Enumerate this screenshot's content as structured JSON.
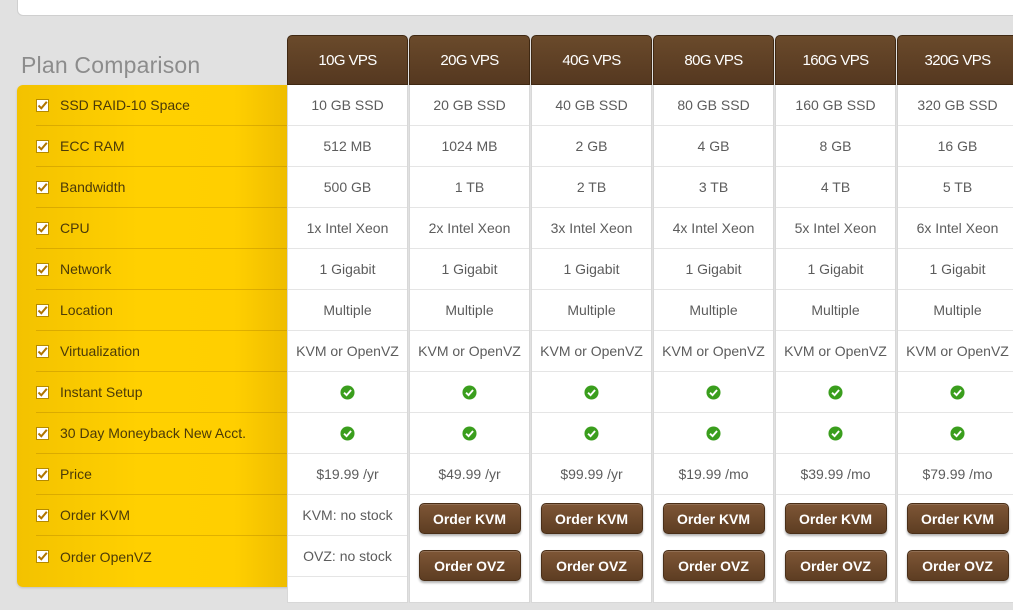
{
  "title": "Plan Comparison",
  "features": [
    "SSD RAID-10 Space",
    "ECC RAM",
    "Bandwidth",
    "CPU",
    "Network",
    "Location",
    "Virtualization",
    "Instant Setup",
    "30 Day Moneyback New Acct.",
    "Price",
    "Order KVM",
    "Order OpenVZ"
  ],
  "plans": [
    {
      "name": "10G VPS",
      "space": "10 GB SSD",
      "ram": "512 MB",
      "bandwidth": "500 GB",
      "cpu": "1x Intel Xeon",
      "network": "1 Gigabit",
      "location": "Multiple",
      "virt": "KVM or OpenVZ",
      "price": "$19.99 /yr",
      "kvm": "KVM: no stock",
      "ovz": "OVZ: no stock"
    },
    {
      "name": "20G VPS",
      "space": "20 GB SSD",
      "ram": "1024 MB",
      "bandwidth": "1 TB",
      "cpu": "2x Intel Xeon",
      "network": "1 Gigabit",
      "location": "Multiple",
      "virt": "KVM or OpenVZ",
      "price": "$49.99 /yr",
      "kvm": "Order KVM",
      "ovz": "Order OVZ"
    },
    {
      "name": "40G VPS",
      "space": "40 GB SSD",
      "ram": "2 GB",
      "bandwidth": "2 TB",
      "cpu": "3x Intel Xeon",
      "network": "1 Gigabit",
      "location": "Multiple",
      "virt": "KVM or OpenVZ",
      "price": "$99.99 /yr",
      "kvm": "Order KVM",
      "ovz": "Order OVZ"
    },
    {
      "name": "80G VPS",
      "space": "80 GB SSD",
      "ram": "4 GB",
      "bandwidth": "3 TB",
      "cpu": "4x Intel Xeon",
      "network": "1 Gigabit",
      "location": "Multiple",
      "virt": "KVM or OpenVZ",
      "price": "$19.99 /mo",
      "kvm": "Order KVM",
      "ovz": "Order OVZ"
    },
    {
      "name": "160G VPS",
      "space": "160 GB SSD",
      "ram": "8 GB",
      "bandwidth": "4 TB",
      "cpu": "5x Intel Xeon",
      "network": "1 Gigabit",
      "location": "Multiple",
      "virt": "KVM or OpenVZ",
      "price": "$39.99 /mo",
      "kvm": "Order KVM",
      "ovz": "Order OVZ"
    },
    {
      "name": "320G VPS",
      "space": "320 GB SSD",
      "ram": "16 GB",
      "bandwidth": "5 TB",
      "cpu": "6x Intel Xeon",
      "network": "1 Gigabit",
      "location": "Multiple",
      "virt": "KVM or OpenVZ",
      "price": "$79.99 /mo",
      "kvm": "Order KVM",
      "ovz": "Order OVZ"
    }
  ],
  "icons": {
    "feature_check": "checkbox-checked-icon",
    "available": "green-check-icon"
  },
  "colors": {
    "accent": "#ffd000",
    "header": "#5e3f24",
    "button": "#6e4a2c",
    "check": "#3a9e1d"
  }
}
